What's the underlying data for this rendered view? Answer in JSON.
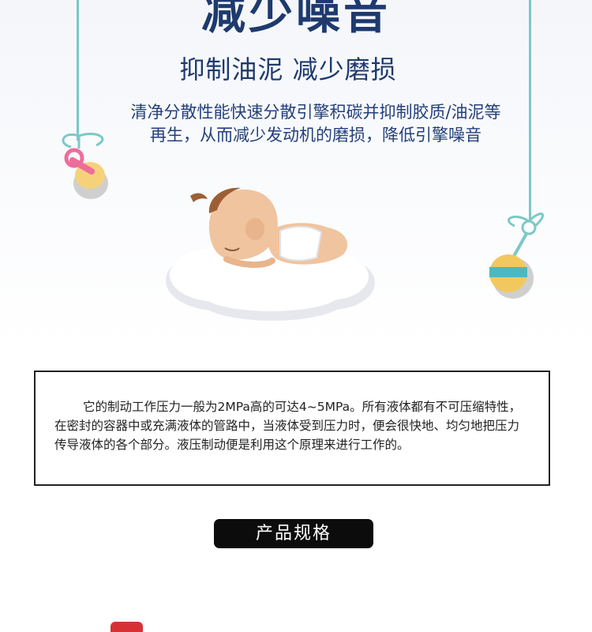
{
  "hero": {
    "title": "减少噪音",
    "subtitle": "抑制油泥  减少磨损",
    "description_line1": "清净分散性能快速分散引擎积碳并抑制胶质/油泥等",
    "description_line2": "再生，从而减少发动机的磨损，降低引擎噪音"
  },
  "info": {
    "text": "它的制动工作压力一般为2MPa高的可达4~5MPa。所有液体都有不可压缩特性，在密封的容器中或充满液体的管路中，当液体受到压力时，便会很快地、均匀地把压力传导液体的各个部分。液压制动便是利用这个原理来进行工作的。"
  },
  "section": {
    "label": "产品规格"
  },
  "colors": {
    "title": "#1e3a6e",
    "string": "#7cc8c7",
    "pill": "#0c0c0c",
    "cap": "#d63236"
  }
}
